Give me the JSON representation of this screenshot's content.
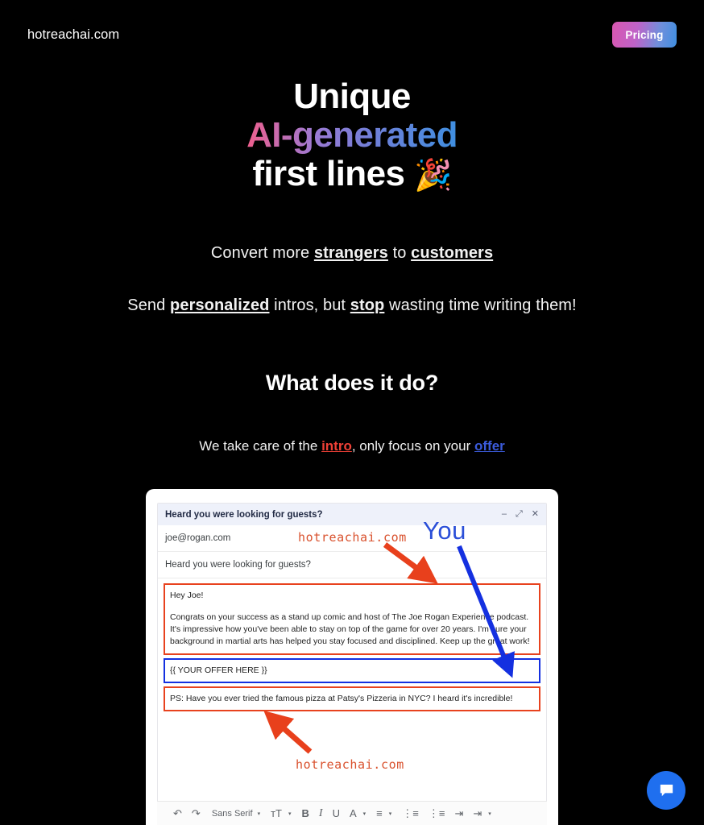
{
  "header": {
    "brand": "hotreachai.com",
    "pricing_label": "Pricing",
    "pricing_gradient_from": "#d957b0",
    "pricing_gradient_to": "#3f8fe0"
  },
  "hero": {
    "line1": "Unique",
    "line2": "AI-generated",
    "line3": "first lines",
    "emoji": "🎉",
    "gradient_from": "#ef5f8d",
    "gradient_to": "#3f8fe0",
    "sub1": {
      "part1": "Convert more ",
      "em1": "strangers",
      "part2": " to ",
      "em2": "customers"
    },
    "sub2": {
      "part1": "Send ",
      "em1": "personalized",
      "part2": " intros, but ",
      "em2": "stop",
      "part3": " wasting time writing them!"
    }
  },
  "section": {
    "title": "What does it do?",
    "sub_part1": "We take care of the ",
    "sub_intro": "intro",
    "sub_part2": ", only focus on your ",
    "sub_offer": "offer",
    "intro_color": "#ef4036",
    "offer_color": "#3b5bdb"
  },
  "compose": {
    "window_title": "Heard you were looking for guests?",
    "minimize_icon": "minimize-icon",
    "expand_icon": "expand-icon",
    "close_icon": "close-icon",
    "recipient": "joe@rogan.com",
    "subject": "Heard you were looking for guests?",
    "intro_greeting": "Hey Joe!",
    "intro_body": "Congrats on your success as a stand up comic and host of The Joe Rogan Experience podcast. It's impressive how you've been able to stay on top of the game for over 20 years. I'm sure your background in martial arts has helped you stay focused and disciplined. Keep up the great work!",
    "offer_placeholder": "{{ YOUR OFFER HERE }}",
    "ps_line": "PS: Have you ever tried the famous pizza at Patsy's Pizzeria in NYC? I heard it's incredible!",
    "intro_box_color": "#e8421e",
    "offer_box_color": "#1430e0"
  },
  "toolbar": {
    "undo": "↶",
    "redo": "↷",
    "font_name": "Sans Serif",
    "caret": "▾",
    "font_size": "тT",
    "bold": "B",
    "italic": "I",
    "underline": "U",
    "text_color": "A",
    "align": "≡",
    "numbered_list": "⋮≡",
    "bulleted_list": "⋮≡",
    "indent_less": "⇥",
    "indent_more": "⇥",
    "more": "▾"
  },
  "annotations": {
    "top_label": "hotreachai.com",
    "bottom_label": "hotreachai.com",
    "you_label": "You",
    "red": "#d9512d",
    "blue": "#2b4fd8"
  },
  "chat": {
    "icon": "chat-bubble-icon",
    "color": "#1f6fef"
  }
}
